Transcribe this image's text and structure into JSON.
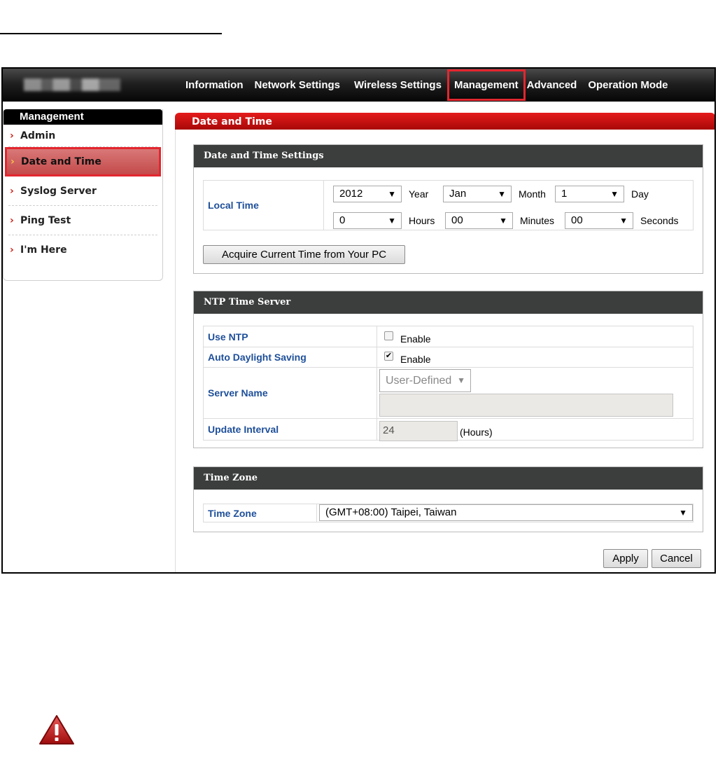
{
  "nav": {
    "tabs": [
      "Information",
      "Network Settings",
      "Wireless Settings",
      "Management",
      "Advanced",
      "Operation Mode"
    ],
    "active": "Management"
  },
  "sidebar": {
    "title": "Management",
    "items": [
      "Admin",
      "Date and Time",
      "Syslog Server",
      "Ping Test",
      "I'm Here"
    ],
    "active": "Date and Time"
  },
  "panel": {
    "title": "Date and Time"
  },
  "date_time_settings": {
    "heading": "Date and Time Settings",
    "local_time_label": "Local Time",
    "year": "2012",
    "year_label": "Year",
    "month": "Jan",
    "month_label": "Month",
    "day": "1",
    "day_label": "Day",
    "hours": "0",
    "hours_label": "Hours",
    "minutes": "00",
    "minutes_label": "Minutes",
    "seconds": "00",
    "seconds_label": "Seconds",
    "acquire_button": "Acquire Current Time from Your PC"
  },
  "ntp": {
    "heading": "NTP Time Server",
    "use_ntp_label": "Use NTP",
    "use_ntp_checked": false,
    "enable_label": "Enable",
    "auto_dst_label": "Auto Daylight Saving",
    "auto_dst_checked": true,
    "server_name_label": "Server Name",
    "server_name_value": "User-Defined",
    "server_custom_value": "",
    "update_interval_label": "Update Interval",
    "update_interval_value": "24",
    "update_interval_unit": "(Hours)"
  },
  "time_zone": {
    "heading": "Time Zone",
    "label": "Time Zone",
    "value": "(GMT+08:00) Taipei, Taiwan"
  },
  "buttons": {
    "apply": "Apply",
    "cancel": "Cancel"
  },
  "icons": {
    "warning": "warning-triangle-icon",
    "arrow": "chevron-right-icon",
    "dropdown": "triangle-down-icon"
  },
  "colors": {
    "accent_red": "#e3262f",
    "panel_red": "#c60f0f",
    "label_blue": "#1e4f9a",
    "section_header": "#3c3d3d"
  }
}
